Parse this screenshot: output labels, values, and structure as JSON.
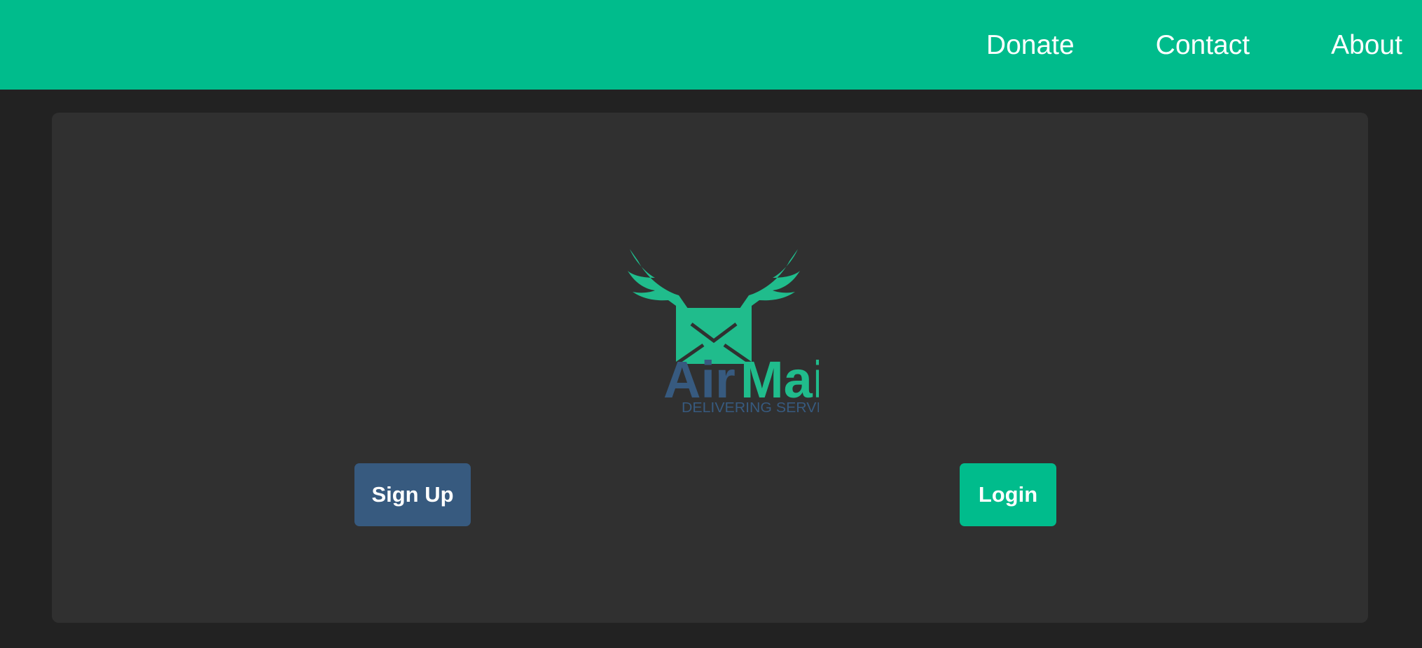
{
  "nav": {
    "items": [
      {
        "label": "Donate"
      },
      {
        "label": "Contact"
      },
      {
        "label": "About"
      }
    ]
  },
  "logo": {
    "word1": "Air",
    "word2": "Mail",
    "tagline": "DELIVERING SERVICE",
    "icon": "winged-envelope-icon",
    "colors": {
      "blue": "#375a7f",
      "green": "#20bc8c"
    }
  },
  "actions": {
    "signup_label": "Sign Up",
    "login_label": "Login"
  },
  "colors": {
    "navbar": "#00bc8c",
    "background": "#222222",
    "card": "#303030",
    "signup_button": "#375a7f",
    "login_button": "#00bc8c"
  }
}
